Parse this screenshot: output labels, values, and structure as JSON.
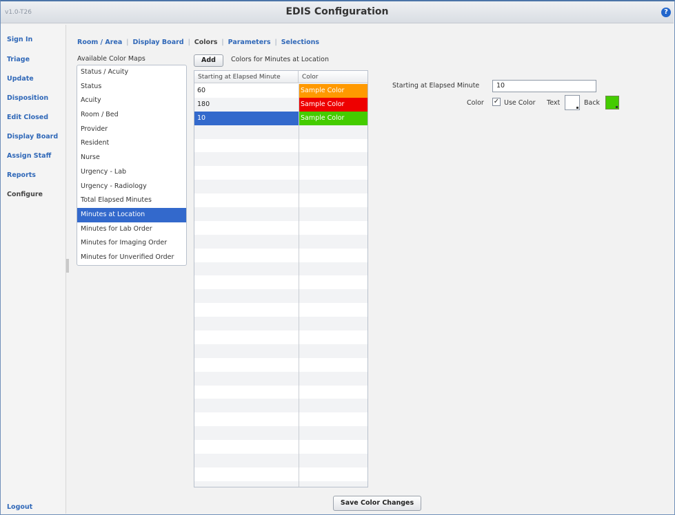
{
  "app": {
    "version": "v1.0-T26",
    "title": "EDIS Configuration",
    "help_icon": "question-icon"
  },
  "sidebar": {
    "items": [
      {
        "label": "Sign In"
      },
      {
        "label": "Triage"
      },
      {
        "label": "Update"
      },
      {
        "label": "Disposition"
      },
      {
        "label": "Edit Closed"
      },
      {
        "label": "Display Board"
      },
      {
        "label": "Assign Staff"
      },
      {
        "label": "Reports"
      },
      {
        "label": "Configure"
      }
    ],
    "logout": "Logout"
  },
  "tabs": [
    {
      "label": "Room / Area"
    },
    {
      "label": "Display Board"
    },
    {
      "label": "Colors"
    },
    {
      "label": "Parameters"
    },
    {
      "label": "Selections"
    }
  ],
  "color_maps": {
    "title": "Available Color Maps",
    "items": [
      "Status / Acuity",
      "Status",
      "Acuity",
      "Room / Bed",
      "Provider",
      "Resident",
      "Nurse",
      "Urgency - Lab",
      "Urgency - Radiology",
      "Total Elapsed Minutes",
      "Minutes at Location",
      "Minutes for Lab Order",
      "Minutes for Imaging Order",
      "Minutes for Unverified Order"
    ],
    "selected_index": 10
  },
  "color_grid": {
    "add_label": "Add",
    "title": "Colors for Minutes at Location",
    "headers": [
      "Starting at Elapsed Minute",
      "Color"
    ],
    "rows": [
      {
        "minute": "60",
        "color_label": "Sample Color",
        "color": "#ff9900"
      },
      {
        "minute": "180",
        "color_label": "Sample Color",
        "color": "#ee0000"
      },
      {
        "minute": "10",
        "color_label": "Sample Color",
        "color": "#44cc00"
      }
    ],
    "selected_row": 2
  },
  "details": {
    "minute_label": "Starting at Elapsed Minute",
    "minute_value": "10",
    "color_label": "Color",
    "use_color_label": "Use Color",
    "use_color_checked": "✓",
    "text_label": "Text",
    "back_label": "Back",
    "text_color": "#ffffff",
    "back_color": "#44cc00"
  },
  "save_label": "Save Color Changes"
}
